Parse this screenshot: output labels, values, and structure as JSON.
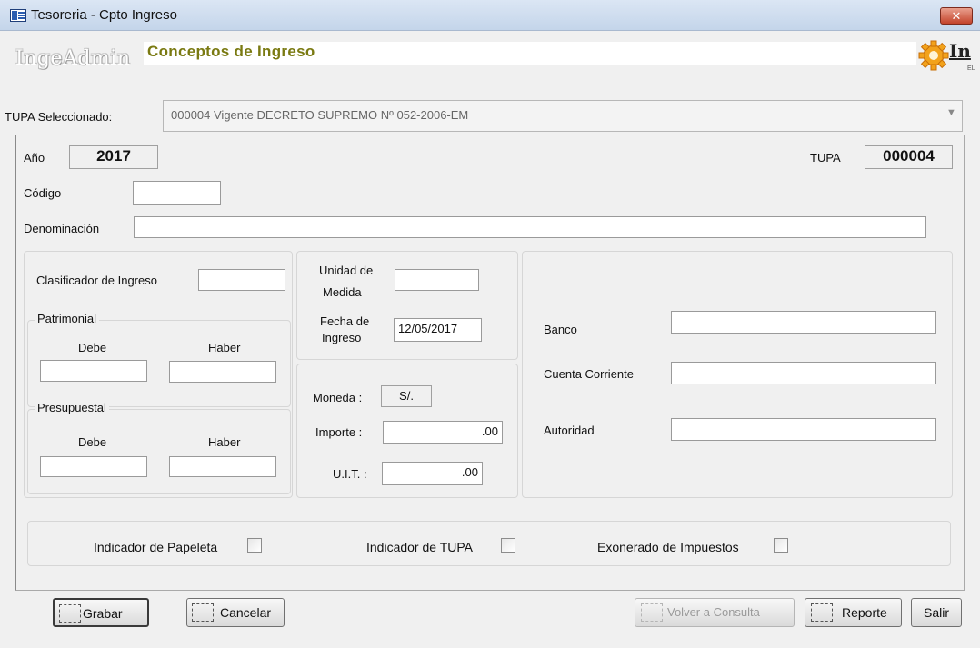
{
  "window": {
    "title": "Tesoreria - Cpto Ingreso",
    "close_label": "✕"
  },
  "header": {
    "brand": "IngeAdmin",
    "title": "Conceptos de Ingreso",
    "logo_text": "In",
    "logo_subtext": "EL"
  },
  "tupa_selector": {
    "label": "TUPA Seleccionado:",
    "value": "000004  Vigente  DECRETO SUPREMO Nº 052-2006-EM"
  },
  "form": {
    "anio_label": "Año",
    "anio_value": "2017",
    "tupa_label": "TUPA",
    "tupa_value": "000004",
    "codigo_label": "Código",
    "codigo_value": "",
    "denominacion_label": "Denominación",
    "denominacion_value": ""
  },
  "clasificador": {
    "label": "Clasificador de Ingreso",
    "value": "",
    "patrimonial": {
      "title": "Patrimonial",
      "debe_label": "Debe",
      "haber_label": "Haber",
      "debe_value": "",
      "haber_value": ""
    },
    "presupuestal": {
      "title": "Presupuestal",
      "debe_label": "Debe",
      "haber_label": "Haber",
      "debe_value": "",
      "haber_value": ""
    }
  },
  "medida": {
    "unidad_label_1": "Unidad de",
    "unidad_label_2": "Medida",
    "unidad_value": "",
    "fecha_label_1": "Fecha de",
    "fecha_label_2": "Ingreso",
    "fecha_value": "12/05/2017"
  },
  "montos": {
    "moneda_label": "Moneda :",
    "moneda_value": "S/.",
    "importe_label": "Importe :",
    "importe_value": ".00",
    "uit_label": "U.I.T. :",
    "uit_value": ".00"
  },
  "banco": {
    "banco_label": "Banco",
    "banco_value": "",
    "cuenta_label": "Cuenta Corriente",
    "cuenta_value": "",
    "autoridad_label": "Autoridad",
    "autoridad_value": ""
  },
  "indicadores": {
    "papeleta_label": "Indicador de Papeleta",
    "papeleta_checked": false,
    "tupa_label": "Indicador de TUPA",
    "tupa_checked": false,
    "exonerado_label": "Exonerado de Impuestos",
    "exonerado_checked": false
  },
  "buttons": {
    "grabar": "Grabar",
    "cancelar": "Cancelar",
    "volver": "Volver a Consulta",
    "reporte": "Reporte",
    "salir": "Salir"
  }
}
